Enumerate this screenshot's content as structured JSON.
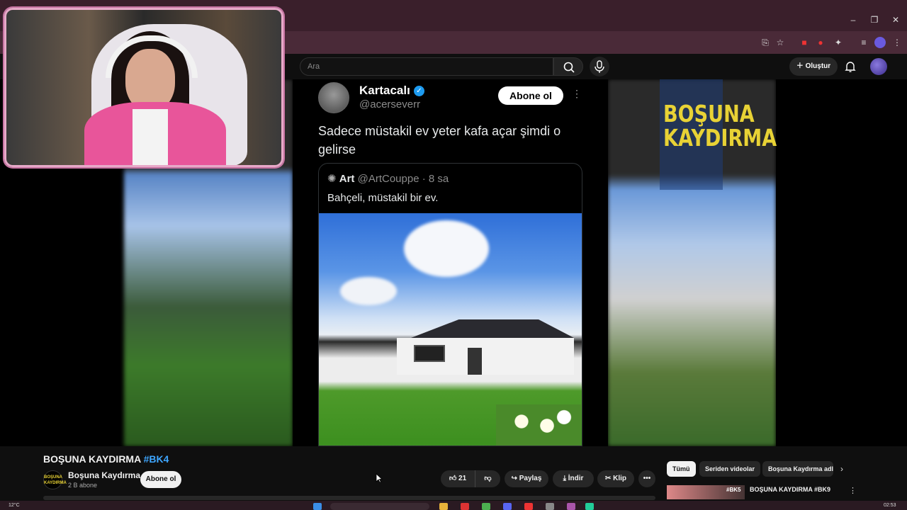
{
  "browser": {
    "window_controls": {
      "minimize": "–",
      "maximize": "❐",
      "close": "✕"
    }
  },
  "header": {
    "search_placeholder": "Ara",
    "create_label": "Oluştur"
  },
  "video": {
    "tweet": {
      "author_name": "Kartacalı",
      "author_handle": "@acerseverr",
      "follow_label": "Abone ol",
      "text": "Sadece müstakil ev yeter kafa açar şimdi o gelirse",
      "quote": {
        "author_name": "Art",
        "author_handle": "@ArtCouppe",
        "age": "· 8 sa",
        "text": "Bahçeli, müstakil bir ev."
      }
    },
    "overlay_logo": "BOŞUNA KAYDIRMA"
  },
  "meta": {
    "title": "BOŞUNA KAYDIRMA",
    "title_tag": "#BK4",
    "channel_name": "Boşuna Kaydırma",
    "channel_avatar_text": "BOŞUNA KAYDIRMA",
    "subscribers": "2 B abone",
    "subscribe_label": "Abone ol"
  },
  "actions": {
    "likes": "21",
    "share": "Paylaş",
    "download": "İndir",
    "clip": "Klip"
  },
  "chips": {
    "all": "Tümü",
    "series": "Seriden videolar",
    "channel": "Boşuna Kaydırma adl"
  },
  "recommendation": {
    "title": "BOŞUNA KAYDIRMA #BK9",
    "thumb_tag": "#BK5"
  },
  "taskbar": {
    "weather": "12°C",
    "clock": "02:53"
  },
  "colors": {
    "accent": "#3ea6ff",
    "logo_yellow": "#e8d235",
    "cam_border": "#e6a9c8",
    "verified": "#1d9bf0"
  }
}
